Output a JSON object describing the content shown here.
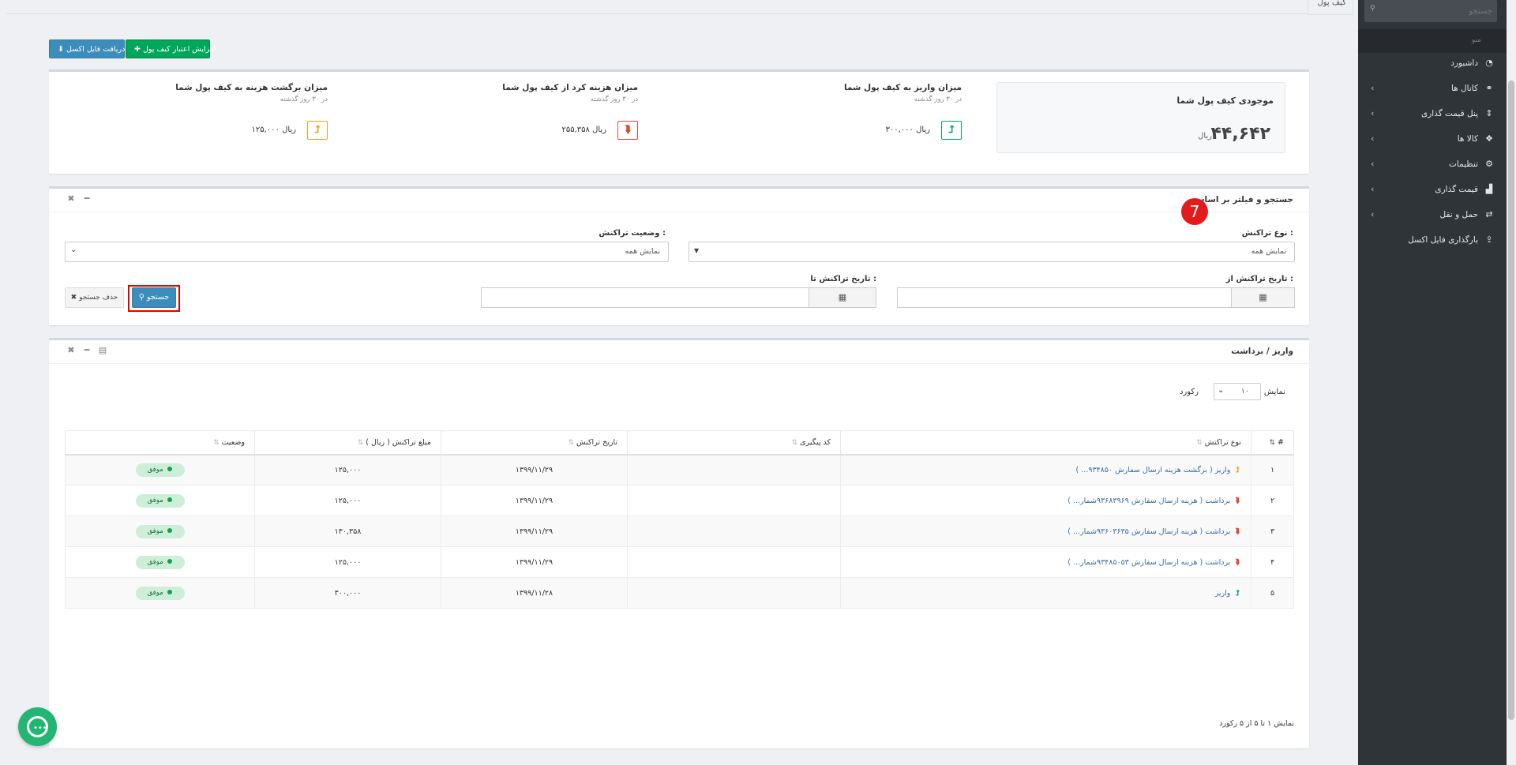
{
  "sidebar": {
    "search_placeholder": "جستجو",
    "section_label": "منو",
    "items": [
      {
        "label": "داشبورد",
        "icon": "dashboard-icon",
        "glyph": "◔",
        "has_children": false
      },
      {
        "label": "کانال ها",
        "icon": "link-icon",
        "glyph": "⚭",
        "has_children": true
      },
      {
        "label": "پنل قیمت گذاری",
        "icon": "sort-icon",
        "glyph": "⇕",
        "has_children": true
      },
      {
        "label": "کالا ها",
        "icon": "cubes-icon",
        "glyph": "❖",
        "has_children": true
      },
      {
        "label": "تنظیمات",
        "icon": "gear-icon",
        "glyph": "⚙",
        "has_children": true
      },
      {
        "label": "قیمت گذاری",
        "icon": "chart-icon",
        "glyph": "▟",
        "has_children": true
      },
      {
        "label": "حمل و نقل",
        "icon": "exchange-icon",
        "glyph": "⇄",
        "has_children": true
      },
      {
        "label": "بارگذاری فایل اکسل",
        "icon": "upload-icon",
        "glyph": "⇪",
        "has_children": false
      }
    ]
  },
  "tab": {
    "label": "کیف پول"
  },
  "toolbar": {
    "add_credit_label": "✚ افزایش اعتبار کیف پول",
    "excel_label": "⬇ دریافت فایل اکسل"
  },
  "summary": {
    "wallet_title": "موجودی کیف پول شما",
    "wallet_amount": "۴۴,۶۴۲",
    "wallet_unit": "ریال",
    "stats": [
      {
        "title": "میزان واریز به کیف پول شما",
        "sub": "در ۳۰ روز گذشته",
        "value": "۳۰۰,۰۰۰ ریال",
        "glyph": "⮥",
        "color": "#00a65a"
      },
      {
        "title": "میزان هزینه کرد از کیف پول شما",
        "sub": "در ۳۰ روز گذشته",
        "value": "۲۵۵,۳۵۸ ریال",
        "glyph": "⮯",
        "color": "#dd4b39"
      },
      {
        "title": "میزان برگشت هزینه به کیف پول شما",
        "sub": "در ۳۰ روز گذشته",
        "value": "۱۲۵,۰۰۰ ریال",
        "glyph": "⮥",
        "color": "#f39c12"
      }
    ]
  },
  "filter": {
    "title": "جستجو و فیلتر بر اساس",
    "badge": "7",
    "type_label": "نوع تراکنش :",
    "type_value": "نمایش همه",
    "status_label": "وضعیت تراکنش :",
    "status_value": "نمایش همه",
    "date_from_label": "تاریخ تراکنش از :",
    "date_to_label": "تاریخ تراکنش تا :",
    "search_label": "جستجو",
    "clear_label": "✖ حذف جستجو"
  },
  "transactions": {
    "title": "واریز / برداشت",
    "show_label": "نمایش",
    "records_label": "رکورد",
    "page_length": "۱۰",
    "columns": [
      "#",
      "نوع تراکنش",
      "کد پیگیری",
      "تاریخ تراکنش",
      "مبلغ تراکنش ( ریال )",
      "وضعیت"
    ],
    "rows": [
      {
        "num": "۱",
        "dir": "up",
        "type": "واریز ( برگشت هزینه ارسال سفارش ۹۳۴۸۵۰... )",
        "code": "",
        "date": "۱۳۹۹/۱۱/۲۹",
        "amount": "۱۲۵,۰۰۰",
        "status": "موفق"
      },
      {
        "num": "۲",
        "dir": "down",
        "type": "برداشت ( هزینه ارسال سفارش ۹۳۶۸۳۹۶۹شمار... )",
        "code": "",
        "date": "۱۳۹۹/۱۱/۲۹",
        "amount": "۱۲۵,۰۰۰",
        "status": "موفق"
      },
      {
        "num": "۳",
        "dir": "down",
        "type": "برداشت ( هزینه ارسال سفارش ۹۳۶۰۳۶۳۵شمار... )",
        "code": "",
        "date": "۱۳۹۹/۱۱/۲۹",
        "amount": "۱۳۰,۳۵۸",
        "status": "موفق"
      },
      {
        "num": "۴",
        "dir": "down",
        "type": "برداشت ( هزینه ارسال سفارش ۹۳۴۸۵۰۵۳شمار... )",
        "code": "",
        "date": "۱۳۹۹/۱۱/۲۹",
        "amount": "۱۲۵,۰۰۰",
        "status": "موفق"
      },
      {
        "num": "۵",
        "dir": "upg",
        "type": "واریز",
        "code": "",
        "date": "۱۳۹۹/۱۱/۲۸",
        "amount": "۳۰۰,۰۰۰",
        "status": "موفق"
      }
    ],
    "info": "نمایش ۱ تا ۵ از ۵ رکورد"
  },
  "colors": {
    "primary": "#3c8dbc",
    "success": "#00a65a",
    "danger": "#dd4b39",
    "warning": "#f39c12",
    "sidebar": "#2f3438"
  }
}
